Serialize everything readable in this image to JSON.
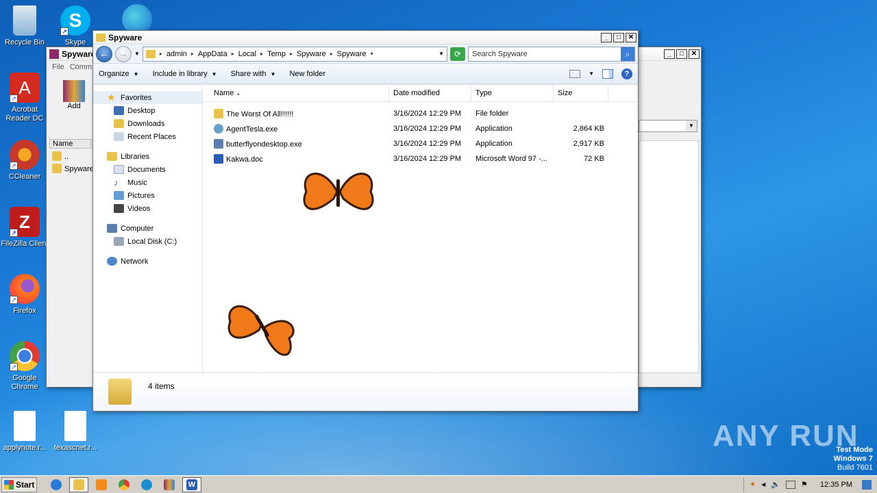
{
  "desktop": {
    "icons": [
      {
        "label": "Recycle Bin",
        "color": "#8ab4d6"
      },
      {
        "label": "Skype",
        "color": "#00aff0"
      },
      {
        "label": "Acrobat Reader DC",
        "color": "#d42a1f"
      },
      {
        "label": "CCleaner",
        "color": "#c7372a"
      },
      {
        "label": "FileZilla Client",
        "color": "#bf1c1c"
      },
      {
        "label": "Firefox",
        "color": "#ff7a1a"
      },
      {
        "label": "Google Chrome",
        "color": "#3b7de0"
      },
      {
        "label": "applynote.r...",
        "color": "#ffffff"
      },
      {
        "label": "texascnet.r...",
        "color": "#ffffff"
      }
    ]
  },
  "back_window": {
    "title": "Spyware",
    "menu": [
      "File",
      "Comm"
    ],
    "add_label": "Add",
    "col_name": "Name",
    "rows": [
      "..",
      "Spyware"
    ]
  },
  "explorer": {
    "title": "Spyware",
    "breadcrumb": [
      "admin",
      "AppData",
      "Local",
      "Temp",
      "Spyware",
      "Spyware"
    ],
    "search_placeholder": "Search Spyware",
    "commands": [
      "Organize",
      "Include in library",
      "Share with",
      "New folder"
    ],
    "nav": {
      "favorites": "Favorites",
      "fav_items": [
        "Desktop",
        "Downloads",
        "Recent Places"
      ],
      "libraries": "Libraries",
      "lib_items": [
        "Documents",
        "Music",
        "Pictures",
        "Videos"
      ],
      "computer": "Computer",
      "computer_items": [
        "Local Disk (C:)"
      ],
      "network": "Network"
    },
    "columns": [
      "Name",
      "Date modified",
      "Type",
      "Size"
    ],
    "files": [
      {
        "name": "The Worst Of All!!!!!!",
        "date": "3/16/2024 12:29 PM",
        "type": "File folder",
        "size": "",
        "icon": "folder-icon",
        "color": "#e8c24a"
      },
      {
        "name": "AgentTesla.exe",
        "date": "3/16/2024 12:29 PM",
        "type": "Application",
        "size": "2,864 KB",
        "icon": "exe-icon",
        "color": "#6aa0c8"
      },
      {
        "name": "butterflyondesktop.exe",
        "date": "3/16/2024 12:29 PM",
        "type": "Application",
        "size": "2,917 KB",
        "icon": "setup-icon",
        "color": "#5a7fae"
      },
      {
        "name": "Kakwa.doc",
        "date": "3/16/2024 12:29 PM",
        "type": "Microsoft Word 97 -...",
        "size": "72 KB",
        "icon": "word-doc-icon",
        "color": "#2b5bb5"
      }
    ],
    "item_count": "4 items"
  },
  "taskbar": {
    "start_label": "Start",
    "clock": "12:35 PM"
  },
  "watermark": {
    "line1": "Test Mode",
    "line2": "Windows 7",
    "line3": "Build 7601",
    "brand": "ANY RUN"
  }
}
